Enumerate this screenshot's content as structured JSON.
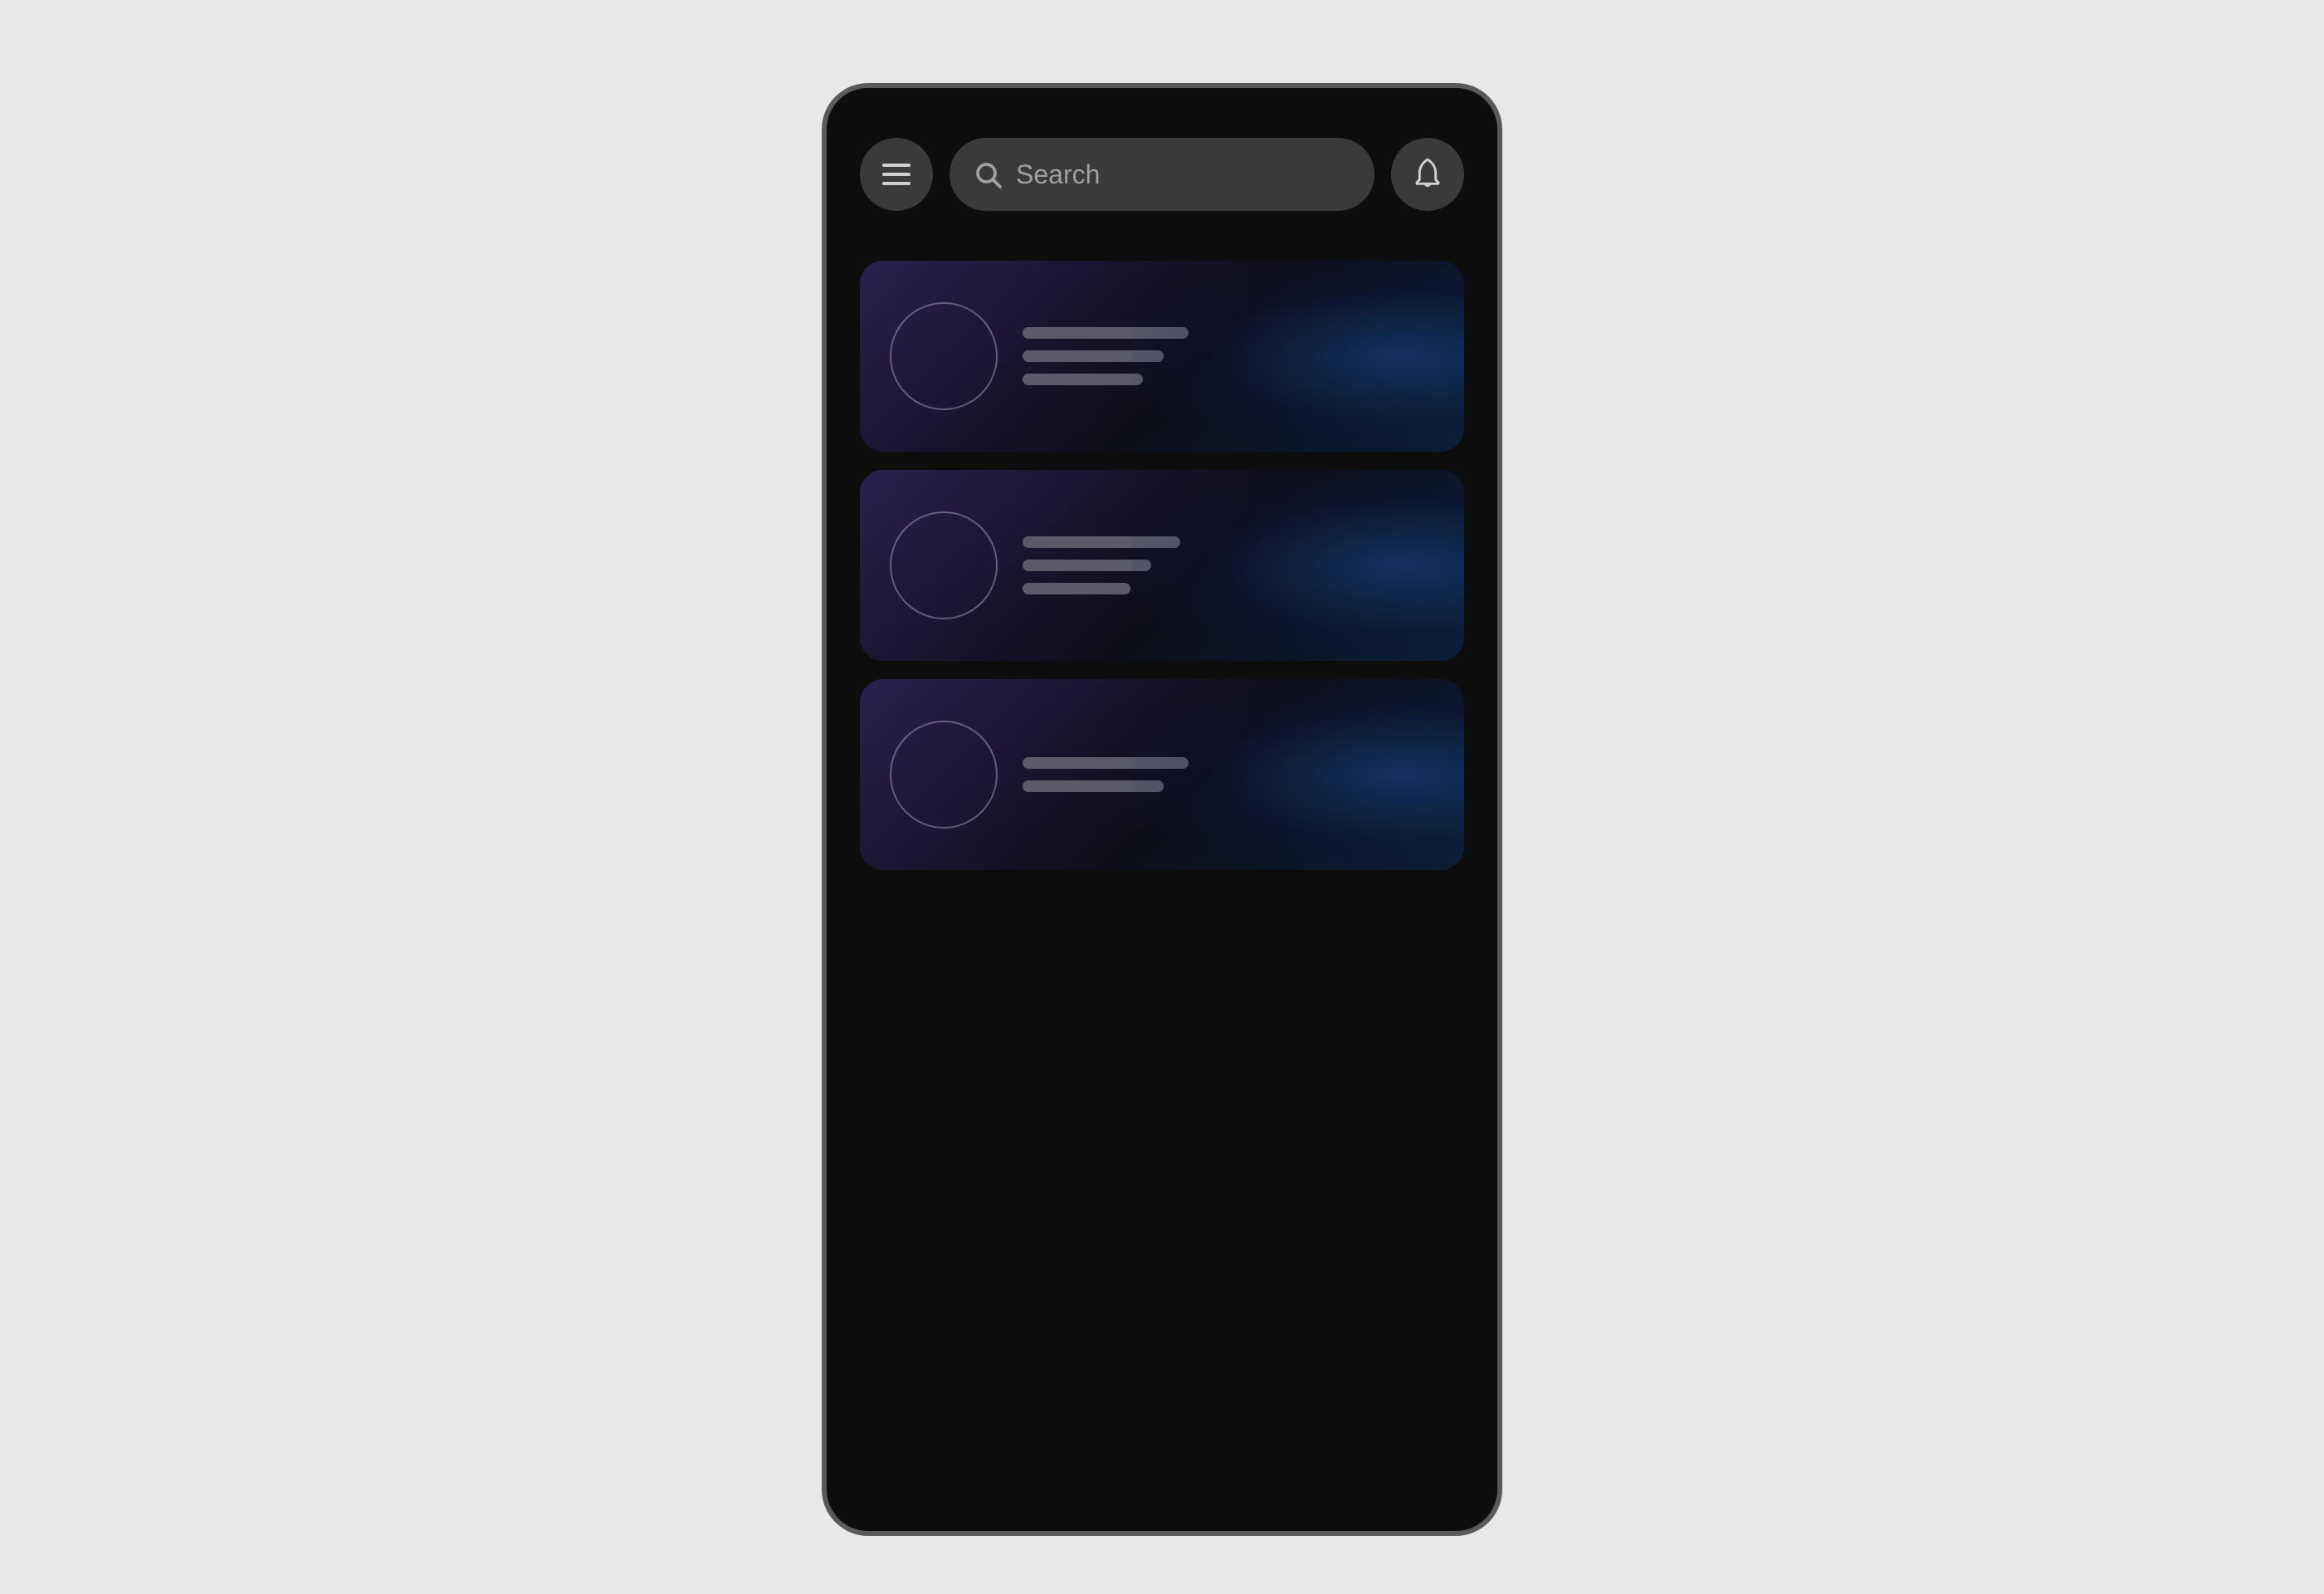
{
  "device": {
    "background": "#e8e8e8"
  },
  "header": {
    "menu_label": "Menu",
    "search_placeholder": "Search",
    "notification_label": "Notifications"
  },
  "list": {
    "cards": [
      {
        "id": "card-1",
        "avatar": "",
        "lines": [
          200,
          170,
          145
        ]
      },
      {
        "id": "card-2",
        "avatar": "",
        "lines": [
          185,
          155,
          130
        ]
      },
      {
        "id": "card-3",
        "avatar": "",
        "lines": [
          195,
          160,
          0
        ]
      }
    ]
  },
  "icons": {
    "menu": "☰",
    "search": "🔍",
    "bell": "🔔"
  }
}
